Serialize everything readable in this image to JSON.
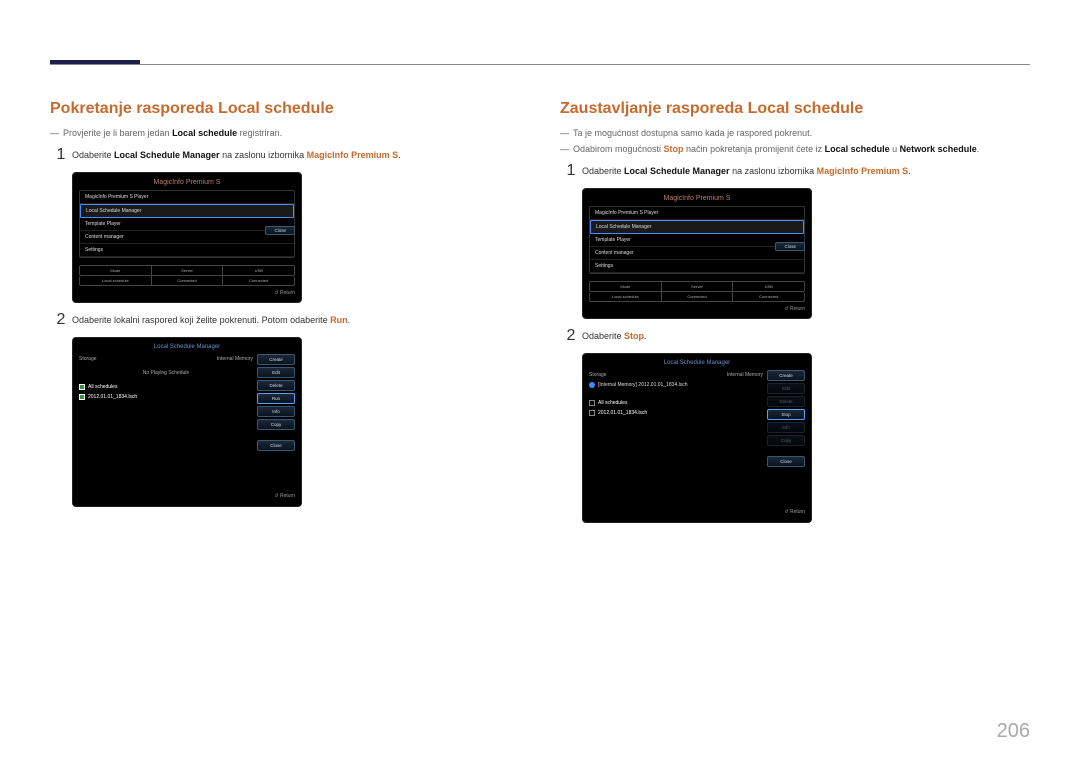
{
  "page_number": "206",
  "left": {
    "title": "Pokretanje rasporeda Local schedule",
    "note_pre": "Provjerite je li barem jedan ",
    "note_bold": "Local schedule",
    "note_post": " registriran.",
    "step1_pre": "Odaberite ",
    "step1_b1": "Local Schedule Manager",
    "step1_mid": " na zaslonu izbornika ",
    "step1_a1": "MagicInfo Premium S",
    "step1_post": ".",
    "step2_pre": "Odaberite lokalni raspored koji želite pokrenuti. Potom odaberite ",
    "step2_a1": "Run",
    "step2_post": "."
  },
  "right": {
    "title": "Zaustavljanje rasporeda Local schedule",
    "note1": "Ta je mogućnost dostupna samo kada je raspored pokrenut.",
    "note2_pre": "Odabirom mogućnosti ",
    "note2_a1": "Stop",
    "note2_mid": " način pokretanja promijenit ćete iz ",
    "note2_b1": "Local schedule",
    "note2_mid2": " u ",
    "note2_b2": "Network schedule",
    "note2_post": ".",
    "step1_pre": "Odaberite ",
    "step1_b1": "Local Schedule Manager",
    "step1_mid": " na zaslonu izbornika ",
    "step1_a1": "MagicInfo Premium S",
    "step1_post": ".",
    "step2_pre": "Odaberite ",
    "step2_a1": "Stop",
    "step2_post": "."
  },
  "menu": {
    "title": "MagicInfo Premium S",
    "items": [
      "MagicInfo Premium S Player",
      "Local Schedule Manager",
      "Template Player",
      "Content manager",
      "Settings"
    ],
    "close": "Close",
    "return": "Return",
    "table": {
      "h1": "Mode",
      "h2": "Server",
      "h3": "USB",
      "v1": "Local schedule",
      "v2": "Connected",
      "v3": "Connected"
    }
  },
  "lsm1": {
    "title": "Local Schedule Manager",
    "storage": "Storage",
    "storage_val": "Internal Memory",
    "no_playing": "No Playing Schedule",
    "all": "All schedules",
    "file": "2012.01.01_1834.lsch",
    "btns": [
      "Create",
      "Edit",
      "Delete",
      "Run",
      "Info",
      "Copy",
      "Close"
    ],
    "return": "Return"
  },
  "lsm2": {
    "title": "Local Schedule Manager",
    "storage": "Storage",
    "storage_val": "Internal Memory",
    "playing": "[Internal Memory] 2012.01.01_1834.lsch",
    "all": "All schedules",
    "file": "2012.01.01_1834.lsch",
    "btns": [
      "Create",
      "Edit",
      "Delete",
      "Stop",
      "Info",
      "Copy",
      "Close"
    ],
    "return": "Return"
  }
}
